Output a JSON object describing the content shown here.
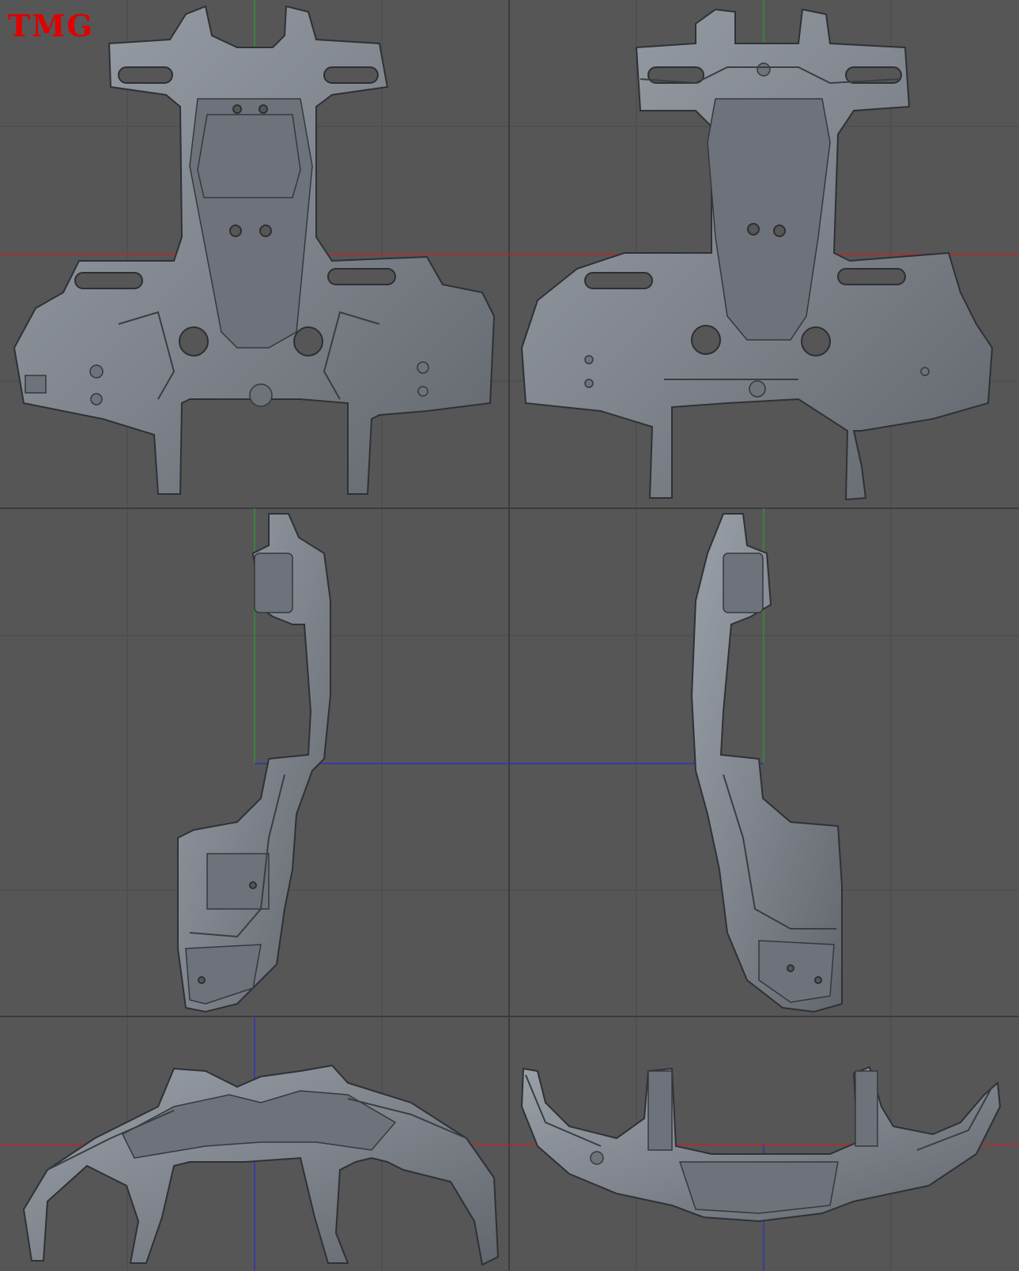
{
  "brand": {
    "label": "TMG",
    "color": "#e00000"
  },
  "colors": {
    "background": "#565656",
    "grid": "#4a4a4a",
    "axis_red": "#cc2020",
    "axis_green": "#2e9a2e",
    "axis_blue": "#2a2ad0",
    "model": "#858a92"
  }
}
